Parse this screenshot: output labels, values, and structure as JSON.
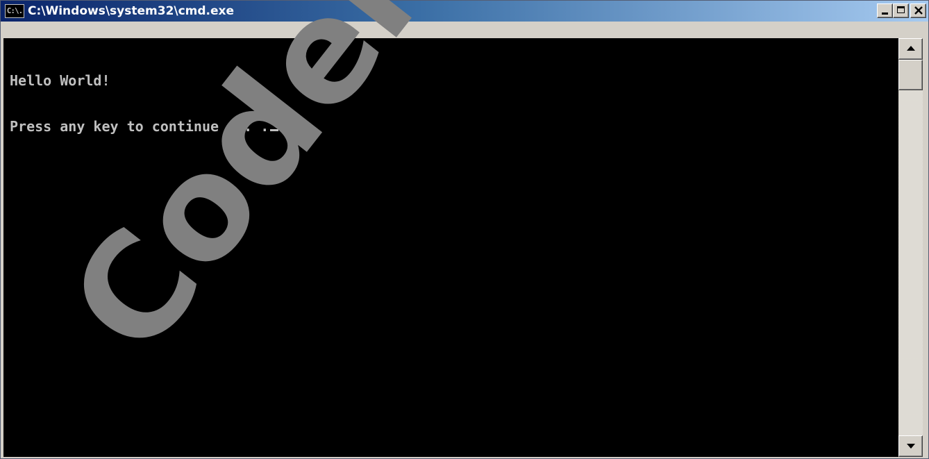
{
  "window": {
    "title": "C:\\Windows\\system32\\cmd.exe",
    "icon_label": "C:\\.",
    "icon_name": "cmd-icon"
  },
  "caption_buttons": {
    "minimize_icon": "minimize-icon",
    "maximize_icon": "maximize-icon",
    "close_icon": "close-icon"
  },
  "console": {
    "lines": [
      "Hello World!",
      "Press any key to continue . . ."
    ],
    "background": "#000000",
    "foreground": "#c0c0c0"
  },
  "watermark": {
    "text": "Coderack",
    "color": "#808080"
  },
  "colors": {
    "titlebar_start": "#0a246a",
    "titlebar_end": "#a6caf0",
    "chrome": "#d4d0c8"
  }
}
